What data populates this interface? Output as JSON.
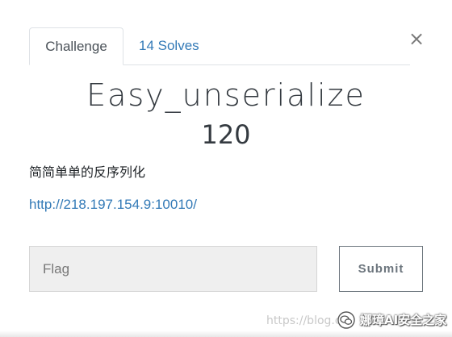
{
  "tabs": [
    {
      "label": "Challenge",
      "active": true
    },
    {
      "label": "14 Solves",
      "active": false
    }
  ],
  "close_symbol": "×",
  "challenge": {
    "name": "Easy_unserialize",
    "value": "120",
    "description": "简简单单的反序列化",
    "link": "http://218.197.154.9:10010/"
  },
  "form": {
    "flag_placeholder": "Flag",
    "submit_label": "Submit"
  },
  "watermark": {
    "url_text": "https://blog.c",
    "account_name": "娜璋AI安全之家",
    "icon": "wechat-icon"
  },
  "colors": {
    "link": "#337ab7",
    "text": "#343a40",
    "input_bg": "#efefef",
    "button_border": "#6c757d"
  }
}
